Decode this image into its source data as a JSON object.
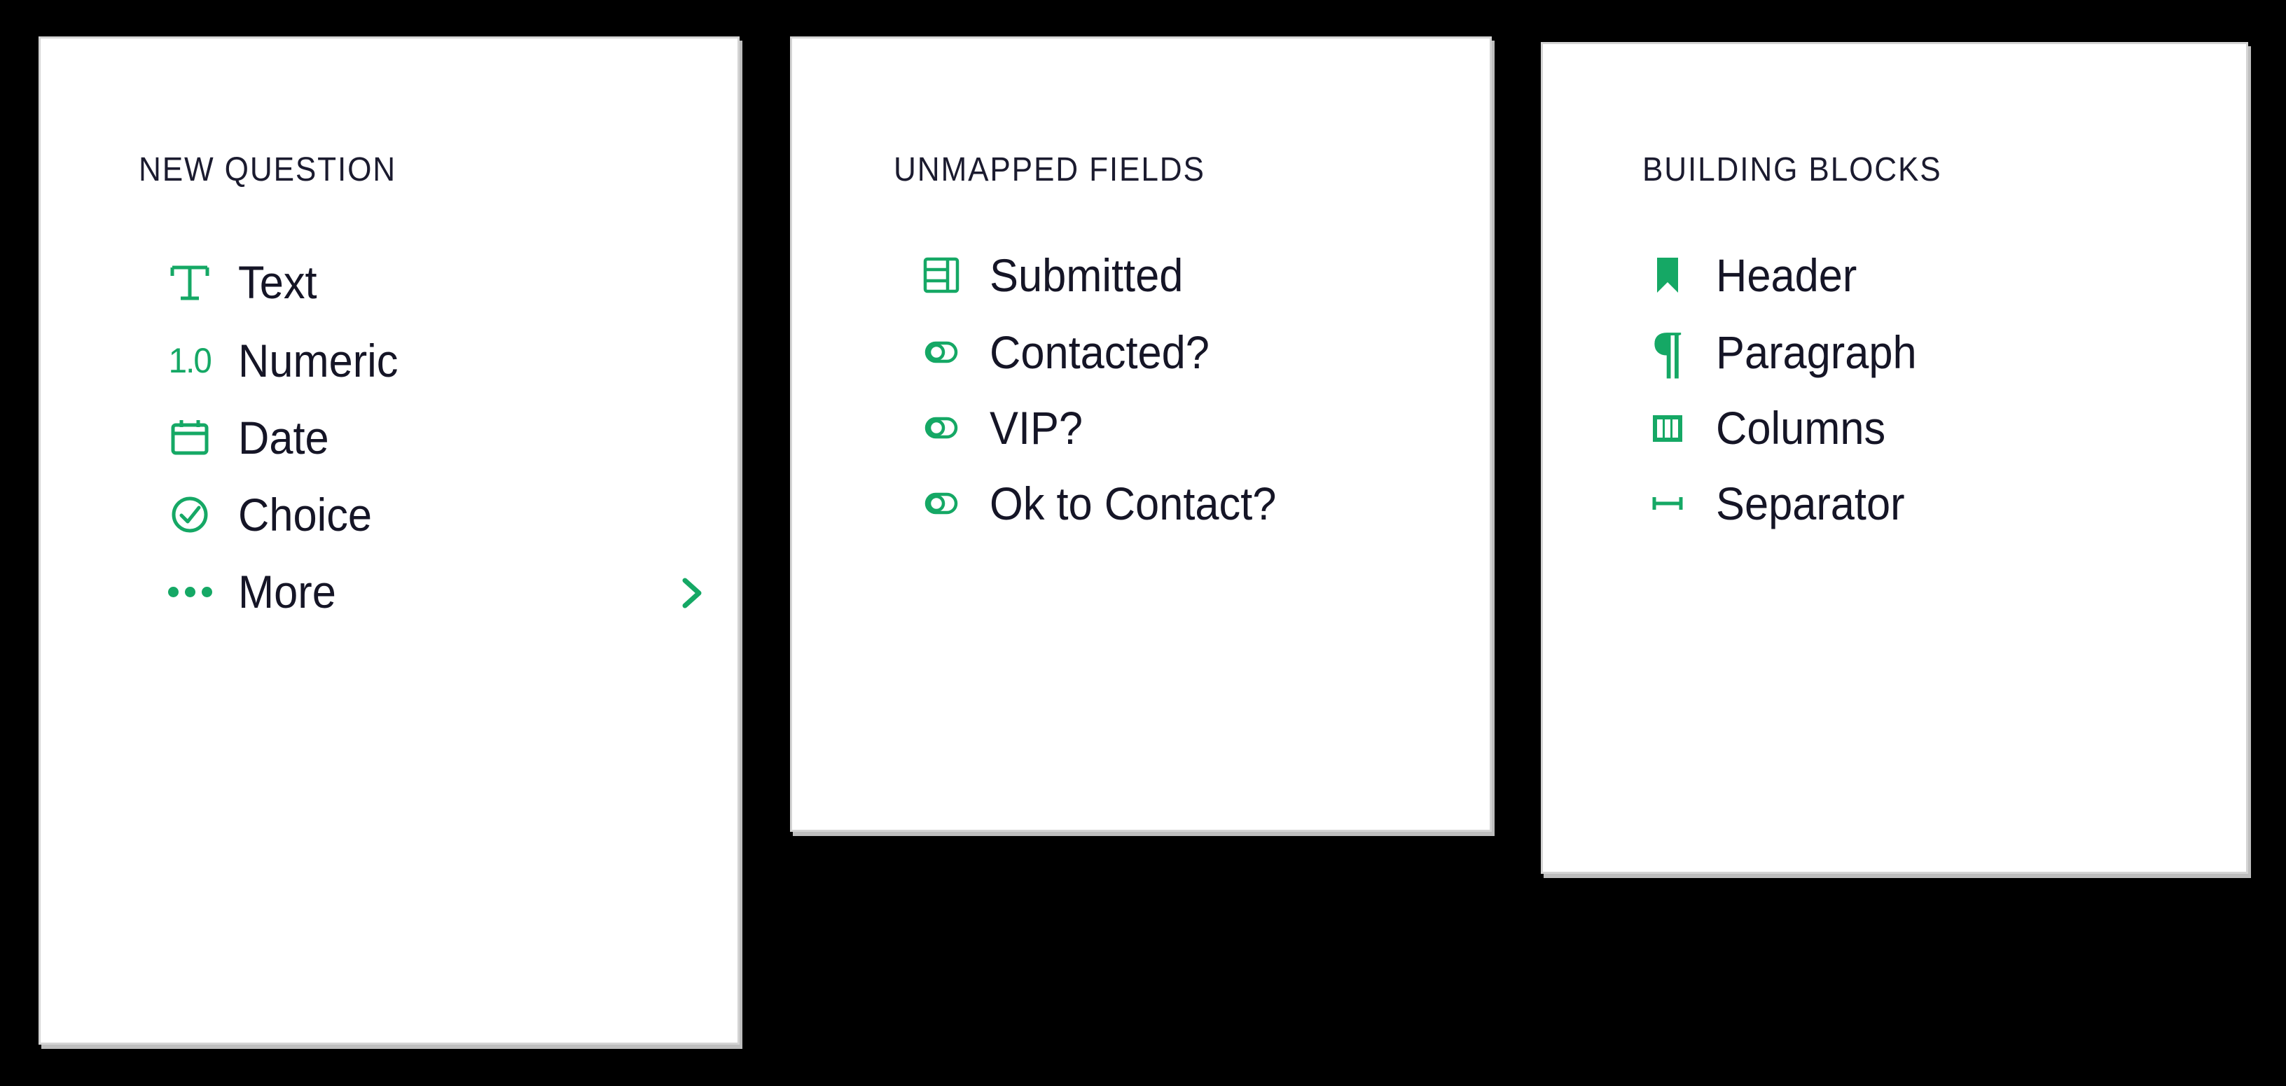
{
  "theme": {
    "background": "#000000",
    "panel_background": "#ffffff",
    "panel_border": "#d4d4d4",
    "accent_green": "#15a865",
    "text_dark": "#151526",
    "title_color": "#1b1b2f"
  },
  "panels": [
    {
      "id": "new-question",
      "title": "NEW QUESTION",
      "items": [
        {
          "label": "Text",
          "icon": "text-t-icon"
        },
        {
          "label": "Numeric",
          "icon": "numeric-1-0-icon",
          "glyph": "1.0"
        },
        {
          "label": "Date",
          "icon": "calendar-icon"
        },
        {
          "label": "Choice",
          "icon": "check-circle-icon"
        },
        {
          "label": "More",
          "icon": "ellipsis-icon",
          "trailing_icon": "chevron-right-icon"
        }
      ]
    },
    {
      "id": "unmapped-fields",
      "title": "UNMAPPED FIELDS",
      "items": [
        {
          "label": "Submitted",
          "icon": "table-layout-icon"
        },
        {
          "label": "Contacted?",
          "icon": "toggle-icon"
        },
        {
          "label": "VIP?",
          "icon": "toggle-icon"
        },
        {
          "label": "Ok to Contact?",
          "icon": "toggle-icon"
        }
      ]
    },
    {
      "id": "building-blocks",
      "title": "BUILDING BLOCKS",
      "items": [
        {
          "label": "Header",
          "icon": "bookmark-icon"
        },
        {
          "label": "Paragraph",
          "icon": "pilcrow-icon",
          "glyph": "¶"
        },
        {
          "label": "Columns",
          "icon": "columns-icon"
        },
        {
          "label": "Separator",
          "icon": "separator-icon"
        }
      ]
    }
  ]
}
